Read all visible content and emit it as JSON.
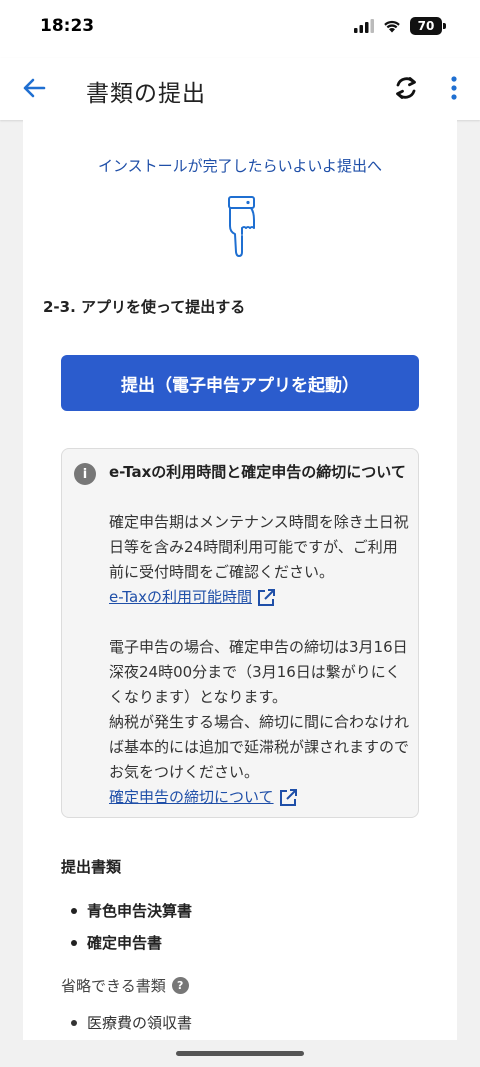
{
  "status_bar": {
    "time": "18:23",
    "battery": "70",
    "icons": [
      "signal-icon",
      "wifi-icon",
      "battery-icon"
    ]
  },
  "app_bar": {
    "title": "書類の提出",
    "icons": [
      "back-arrow-icon",
      "sync-icon",
      "more-vert-icon"
    ],
    "accent": "#1f6fd1"
  },
  "content": {
    "install_text": "インストールが完了したらいよいよ提出へ",
    "step_heading": "2-3. アプリを使って提出する",
    "submit_button": "提出（電子申告アプリを起動）",
    "info": {
      "title": "e-Taxの利用時間と確定申告の締切について",
      "para1": "確定申告期はメンテナンス時間を除き土日祝日等を含み24時間利用可能ですが、ご利用前に受付時間をご確認ください。",
      "link1": "e-Taxの利用可能時間",
      "para2": "電子申告の場合、確定申告の締切は3月16日深夜24時00分まで（3月16日は繋がりにくくなります）となります。",
      "para3": "納税が発生する場合、締切に間に合わなければ基本的には追加で延滞税が課されますのでお気をつけください。",
      "link2": "確定申告の締切について"
    },
    "docs_heading": "提出書類",
    "docs": [
      "青色申告決算書",
      "確定申告書"
    ],
    "omit_heading": "省略できる書類",
    "omit_items": [
      "医療費の領収書"
    ]
  },
  "colors": {
    "primary_button": "#2b5ccd",
    "link": "#1f4fa8"
  }
}
